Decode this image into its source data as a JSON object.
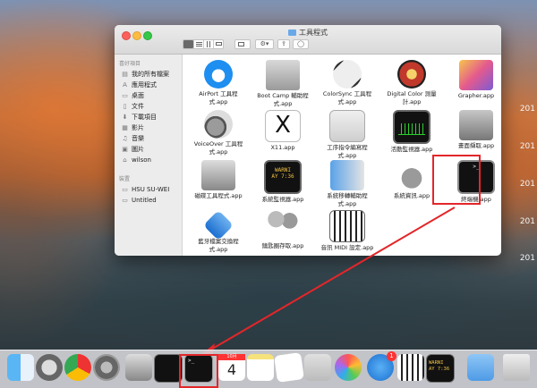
{
  "desktop": {
    "labels": [
      "201",
      "201",
      "201",
      "201",
      "201"
    ]
  },
  "window": {
    "title": "工具程式",
    "toolbar": {
      "back": "‹",
      "forward": "›",
      "gear": "⚙▾",
      "share": "⇪",
      "tag": "◯"
    }
  },
  "sidebar": {
    "favorites_header": "喜好項目",
    "favorites": [
      {
        "label": "我的所有檔案",
        "icon": "▤"
      },
      {
        "label": "應用程式",
        "icon": "A"
      },
      {
        "label": "桌面",
        "icon": "▭"
      },
      {
        "label": "文件",
        "icon": "▯"
      },
      {
        "label": "下載項目",
        "icon": "⬇"
      },
      {
        "label": "影片",
        "icon": "▦"
      },
      {
        "label": "音樂",
        "icon": "♫"
      },
      {
        "label": "圖片",
        "icon": "▣"
      },
      {
        "label": "wilson",
        "icon": "⌂"
      }
    ],
    "devices_header": "裝置",
    "devices": [
      {
        "label": "HSU SU-WEI",
        "icon": "▭"
      },
      {
        "label": "Untitled",
        "icon": "▭"
      }
    ]
  },
  "apps": [
    {
      "label": "AirPort 工具程\n式.app",
      "icon": "wifi-icon"
    },
    {
      "label": "Boot Camp 輔助程\n式.app",
      "icon": "bootcamp-icon"
    },
    {
      "label": "ColorSync 工具程\n式.app",
      "icon": "colorsync-icon"
    },
    {
      "label": "Digital Color 測量\n計.app",
      "icon": "digitalcolor-icon"
    },
    {
      "label": "Grapher.app",
      "icon": "grapher-icon"
    },
    {
      "label": "VoiceOver 工具程\n式.app",
      "icon": "voiceover-icon"
    },
    {
      "label": "X11.app",
      "icon": "x11-icon"
    },
    {
      "label": "工序指令編寫程\n式.app",
      "icon": "script-editor-icon"
    },
    {
      "label": "活動監視器.app",
      "icon": "activity-monitor-icon"
    },
    {
      "label": "畫面擷取.app",
      "icon": "grab-icon"
    },
    {
      "label": "磁碟工具程式.app",
      "icon": "disk-utility-icon"
    },
    {
      "label": "系統監視器.app",
      "icon": "console-icon"
    },
    {
      "label": "系統移轉輔助程\n式.app",
      "icon": "migration-icon"
    },
    {
      "label": "系統資訊.app",
      "icon": "system-info-icon"
    },
    {
      "label": "終端機.app",
      "icon": "terminal-icon"
    },
    {
      "label": "藍牙檔案交換程\n式.app",
      "icon": "bluetooth-icon"
    },
    {
      "label": "鑰匙圈存取.app",
      "icon": "keychain-icon"
    },
    {
      "label": "音訊 MIDI 設定.app",
      "icon": "midi-icon"
    }
  ],
  "console_icon_text": "WARNI\nAY 7:36",
  "dock": {
    "calendar_month": "10月",
    "calendar_day": "4",
    "appstore_badge": "1",
    "console_text": "WARNI\nAY 7:36"
  },
  "colors": {
    "highlight": "#e3262a",
    "folder": "#6aa9e9"
  }
}
